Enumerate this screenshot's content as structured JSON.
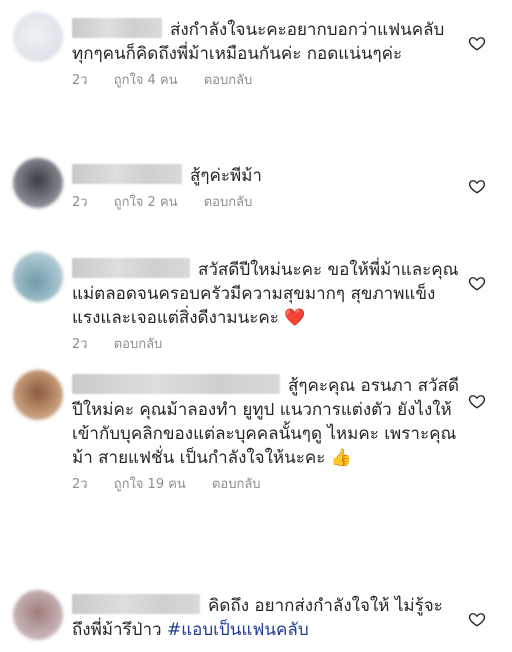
{
  "comments": [
    {
      "text": "ส่งกำลังใจนะคะอยากบอกว่าแฟนคลับทุกๆคนก็คิดถึงพี่ม้าเหมือนกันค่ะ กอดแน่นๆค่ะ",
      "time": "2ว",
      "likes": "ถูกใจ 4 คน",
      "reply": "ตอบกลับ"
    },
    {
      "text": "สู้ๆค่ะพีม้า",
      "time": "2ว",
      "likes": "ถูกใจ 2 คน",
      "reply": "ตอบกลับ"
    },
    {
      "text": "สวัสดีปีใหม่นะคะ ขอให้พี่ม้าและคุณแม่ตลอดจนครอบครัวมีความสุขมากๆ สุขภาพแข็งแรงและเจอแต่สิ่งดีงามนะคะ",
      "emoji": "❤️",
      "time": "2ว",
      "reply": "ตอบกลับ"
    },
    {
      "text": "สู้ๆคะคุณ อรนภา สวัสดีปีใหม่คะ คุณม้าลองทำ ยูทูป แนวการแต่งตัว ยังไงให้เข้ากับบุคลิกของแต่ละบุคคลนั้นๆดู ไหมคะ เพราะคุณม้า สายแฟชั่น เป็นกำลังใจให้นะคะ",
      "emoji": "👍",
      "time": "2ว",
      "likes": "ถูกใจ 19 คน",
      "reply": "ตอบกลับ"
    },
    {
      "text": "คิดถึง อยากส่งกำลังใจให้ ไม่รู้จะถึงพี่ม้ารึป่าว",
      "hashtag": "#แอบเป็นแฟนคลับ"
    }
  ],
  "icons": {
    "like": "heart-outline-icon"
  },
  "colors": {
    "meta": "#8e8e8e",
    "hashtag": "#1f3a93",
    "text": "#262626"
  }
}
